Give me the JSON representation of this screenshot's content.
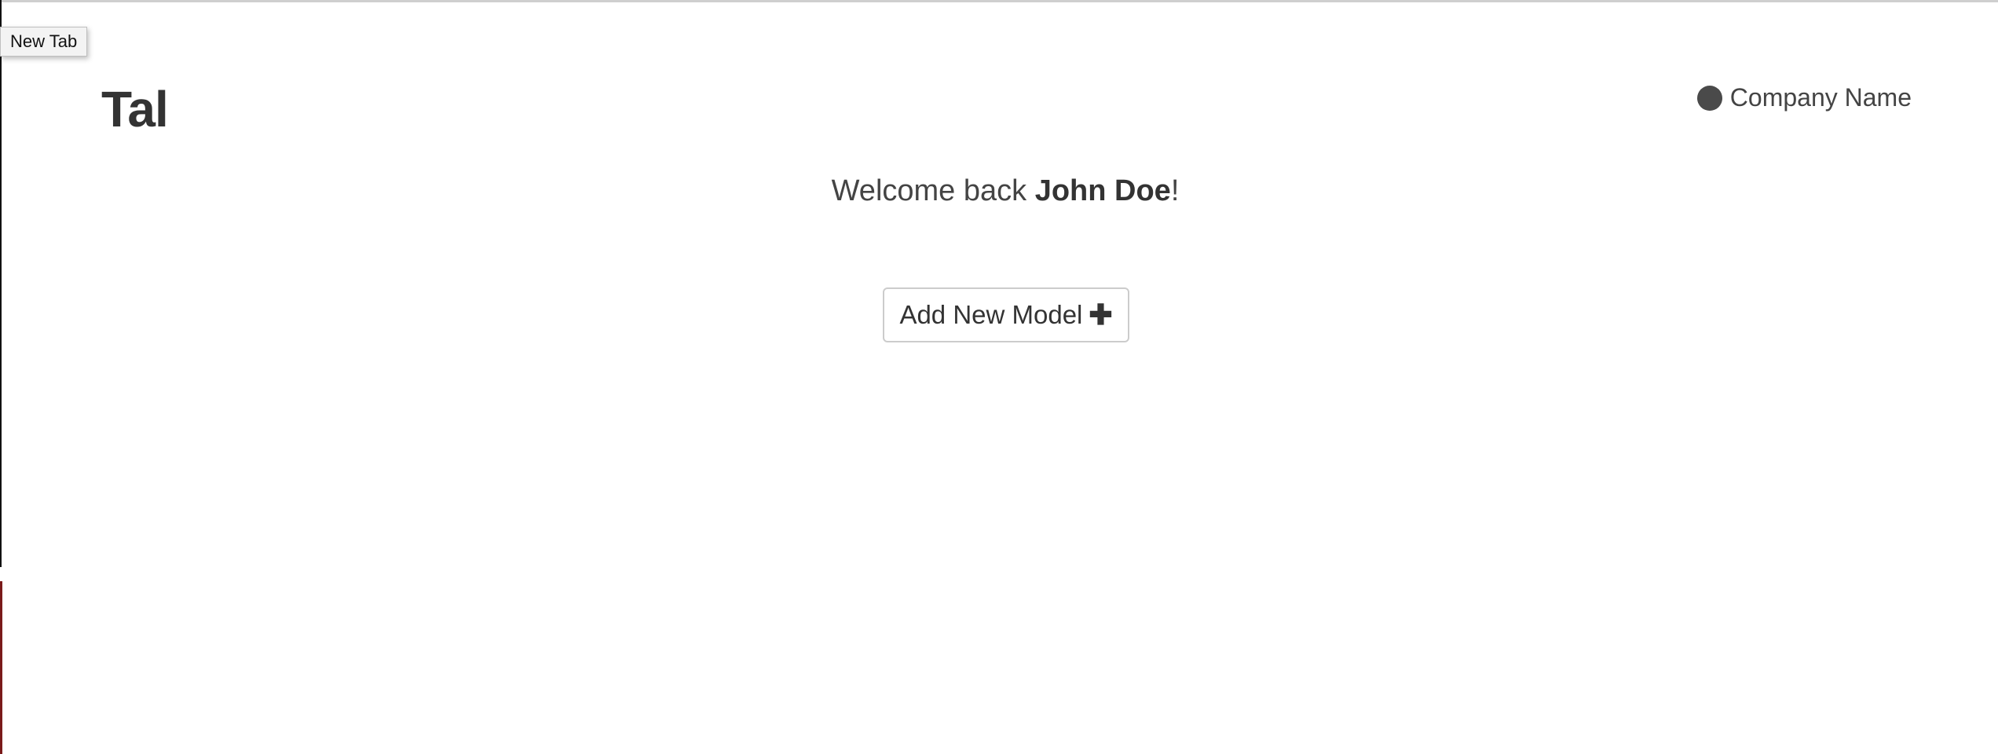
{
  "tooltip": {
    "text": "New Tab"
  },
  "header": {
    "brand": "Tal",
    "company_name": "Company Name",
    "company_icon": "circle-icon"
  },
  "welcome": {
    "prefix": "Welcome back ",
    "user_name": "John Doe",
    "suffix": "!"
  },
  "actions": {
    "add_model_label": "Add New Model",
    "add_model_icon": "plus-icon"
  },
  "colors": {
    "text": "#333333",
    "muted": "#444444",
    "button_border": "#cccccc",
    "background": "#ffffff"
  }
}
